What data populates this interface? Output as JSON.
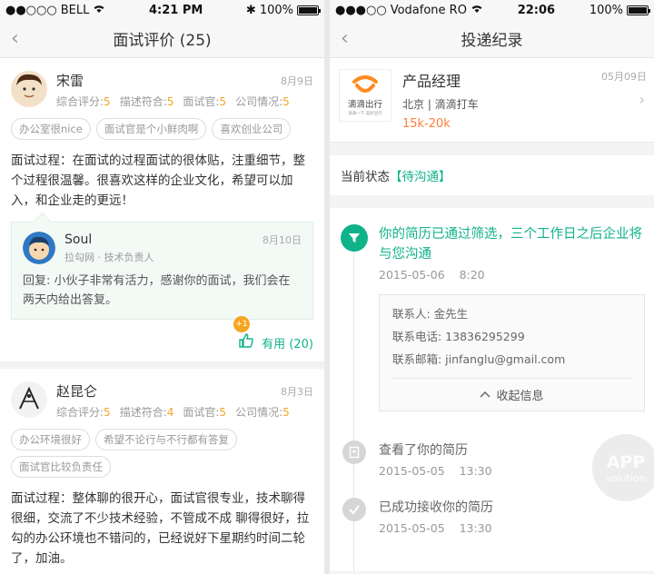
{
  "left": {
    "status": {
      "carrier": "BELL",
      "time": "4:21 PM",
      "battery": "100%"
    },
    "nav": {
      "title": "面试评价 (25)"
    },
    "reviews": [
      {
        "name": "宋雷",
        "date": "8月9日",
        "scores": [
          {
            "label": "综合评分:",
            "value": "5"
          },
          {
            "label": "描述符合:",
            "value": "5"
          },
          {
            "label": "面试官:",
            "value": "5"
          },
          {
            "label": "公司情况:",
            "value": "5"
          }
        ],
        "tags": [
          "办公室很nice",
          "面试官是个小鲜肉啊",
          "喜欢创业公司"
        ],
        "text": "面试过程：在面试的过程面试的很体贴，注重细节，整个过程很温馨。很喜欢这样的企业文化，希望可以加入，和企业走的更远！",
        "reply": {
          "name": "Soul",
          "date": "8月10日",
          "sub": "拉勾网 · 技术负责人",
          "text": "回复: 小伙子非常有活力，感谢你的面试，我们会在两天内给出答复。"
        },
        "plus_badge": "+1",
        "useful": "有用 (20)"
      },
      {
        "name": "赵昆仑",
        "date": "8月3日",
        "scores": [
          {
            "label": "综合评分:",
            "value": "5"
          },
          {
            "label": "描述符合:",
            "value": "4"
          },
          {
            "label": "面试官:",
            "value": "5"
          },
          {
            "label": "公司情况:",
            "value": "5"
          }
        ],
        "tags": [
          "办公环境很好",
          "希望不论行与不行都有答复",
          "面试官比较负责任"
        ],
        "text": "面试过程：整体聊的很开心，面试官很专业，技术聊得很细，交流了不少技术经验，不管成不成 聊得很好，拉勾的办公环境也不错问的，已经说好下星期约时间二轮了，加油。"
      }
    ]
  },
  "right": {
    "status": {
      "carrier": "Vodafone RO",
      "time": "22:06",
      "battery": "100%"
    },
    "nav": {
      "title": "投递纪录"
    },
    "job": {
      "title": "产品经理",
      "date": "05月09日",
      "company": "北京 | 滴滴打车",
      "salary": "15k-20k",
      "logo_name": "滴滴出行",
      "logo_slogan": "滴滴一下 美好出行"
    },
    "state": {
      "label": "当前状态",
      "value": "【待沟通】"
    },
    "timeline": [
      {
        "text": "你的简历已通过筛选，三个工作日之后企业将与您沟通",
        "date": "2015-05-06",
        "time": "8:20",
        "contact": {
          "name": "联系人:  金先生",
          "phone": "联系电话:  13836295299",
          "email": "联系邮箱:  jinfanglu@gmail.com",
          "toggle": "收起信息"
        }
      },
      {
        "text": "查看了你的简历",
        "date": "2015-05-05",
        "time": "13:30"
      },
      {
        "text": "已成功接收你的简历",
        "date": "2015-05-05",
        "time": "13:30"
      }
    ],
    "watermark": {
      "line1": "APP",
      "line2": "solution"
    }
  },
  "colors": {
    "accent": "#10b28a",
    "score": "#f5a623",
    "salary": "#ff7f3e"
  }
}
